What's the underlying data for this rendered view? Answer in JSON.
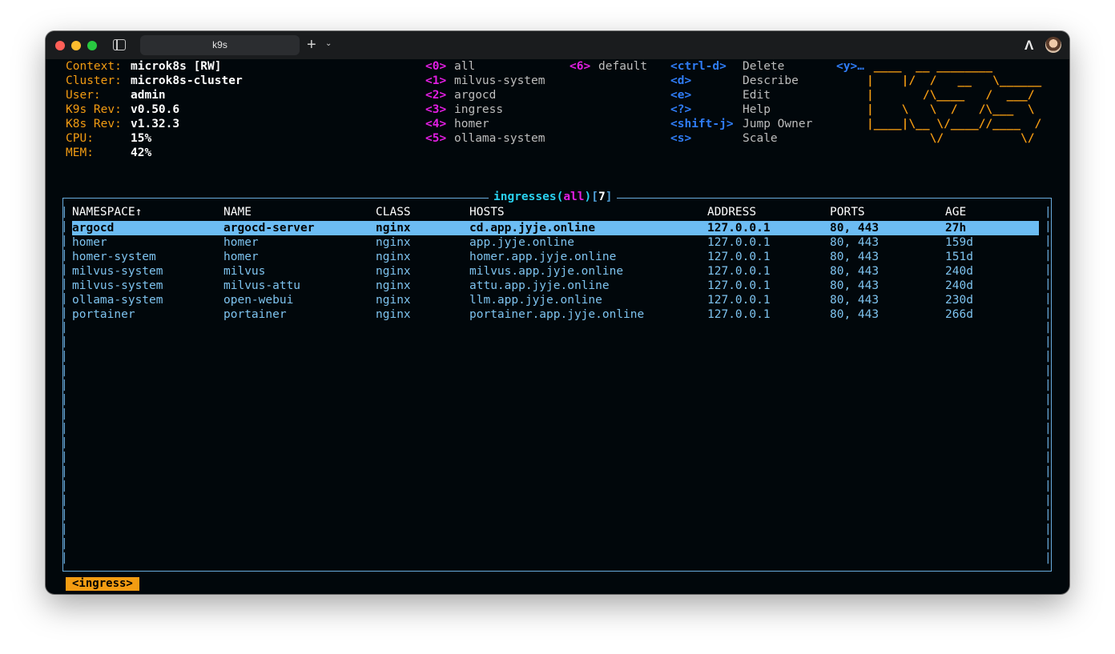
{
  "window": {
    "tab_title": "k9s",
    "new_tab_icon": "plus-icon",
    "tab_menu_icon": "chevron-down-icon",
    "sidebar_icon": "sidebar-icon",
    "ai_icon": "ai-agent-icon",
    "avatar_icon": "user-avatar"
  },
  "info": {
    "context_label": "Context:",
    "context_value": "microk8s [RW]",
    "cluster_label": "Cluster:",
    "cluster_value": "microk8s-cluster",
    "user_label": "User:",
    "user_value": "admin",
    "k9s_rev_label": "K9s Rev:",
    "k9s_rev_value": "v0.50.6",
    "k8s_rev_label": "K8s Rev:",
    "k8s_rev_value": "v1.32.3",
    "cpu_label": "CPU:",
    "cpu_value": "15%",
    "mem_label": "MEM:",
    "mem_value": "42%"
  },
  "namespaces": [
    {
      "key": "<0>",
      "name": "all"
    },
    {
      "key": "<1>",
      "name": "milvus-system"
    },
    {
      "key": "<2>",
      "name": "argocd"
    },
    {
      "key": "<3>",
      "name": "ingress"
    },
    {
      "key": "<4>",
      "name": "homer"
    },
    {
      "key": "<5>",
      "name": "ollama-system"
    },
    {
      "key": "<6>",
      "name": "default"
    }
  ],
  "hotkeys": [
    {
      "key": "<ctrl-d>",
      "action": "Delete"
    },
    {
      "key": "<d>",
      "action": "Describe"
    },
    {
      "key": "<e>",
      "action": "Edit"
    },
    {
      "key": "<?>",
      "action": "Help"
    },
    {
      "key": "<shift-j>",
      "action": "Jump Owner"
    },
    {
      "key": "<s>",
      "action": "Scale"
    },
    {
      "key": "<y>…",
      "action": ""
    }
  ],
  "logo": [
    " ____  __ ________       ",
    "|    |/  /   __   \\______",
    "|       /\\____   /  ___/",
    "|    \\   \\  /   /\\___  \\",
    "|____|\\__ \\/____//____  /",
    "         \\/           \\/ "
  ],
  "resource": {
    "title_name": "ingresses",
    "title_ns": "all",
    "title_count": "7",
    "paren_open": "(",
    "paren_close": ")",
    "bracket_open": "[",
    "bracket_close": "]"
  },
  "table": {
    "columns": [
      "NAMESPACE↑",
      "NAME",
      "CLASS",
      "HOSTS",
      "ADDRESS",
      "PORTS",
      "AGE"
    ],
    "selected_index": 0,
    "rows": [
      [
        "argocd",
        "argocd-server",
        "nginx",
        "cd.app.jyje.online",
        "127.0.0.1",
        "80, 443",
        "27h"
      ],
      [
        "homer",
        "homer",
        "nginx",
        "app.jyje.online",
        "127.0.0.1",
        "80, 443",
        "159d"
      ],
      [
        "homer-system",
        "homer",
        "nginx",
        "homer.app.jyje.online",
        "127.0.0.1",
        "80, 443",
        "151d"
      ],
      [
        "milvus-system",
        "milvus",
        "nginx",
        "milvus.app.jyje.online",
        "127.0.0.1",
        "80, 443",
        "240d"
      ],
      [
        "milvus-system",
        "milvus-attu",
        "nginx",
        "attu.app.jyje.online",
        "127.0.0.1",
        "80, 443",
        "240d"
      ],
      [
        "ollama-system",
        "open-webui",
        "nginx",
        "llm.app.jyje.online",
        "127.0.0.1",
        "80, 443",
        "230d"
      ],
      [
        "portainer",
        "portainer",
        "nginx",
        "portainer.app.jyje.online",
        "127.0.0.1",
        "80, 443",
        "266d"
      ]
    ]
  },
  "breadcrumb": "<ingress>",
  "colors": {
    "background": "#01070b",
    "label_orange": "#f39c12",
    "namespace_key_magenta": "#e21ee2",
    "hotkey_blue": "#2f7cf5",
    "border_blue": "#69acde",
    "row_text": "#7ec3ef",
    "selected_row_bg": "#6cbcf3",
    "title_cyan": "#2ad2f0"
  }
}
